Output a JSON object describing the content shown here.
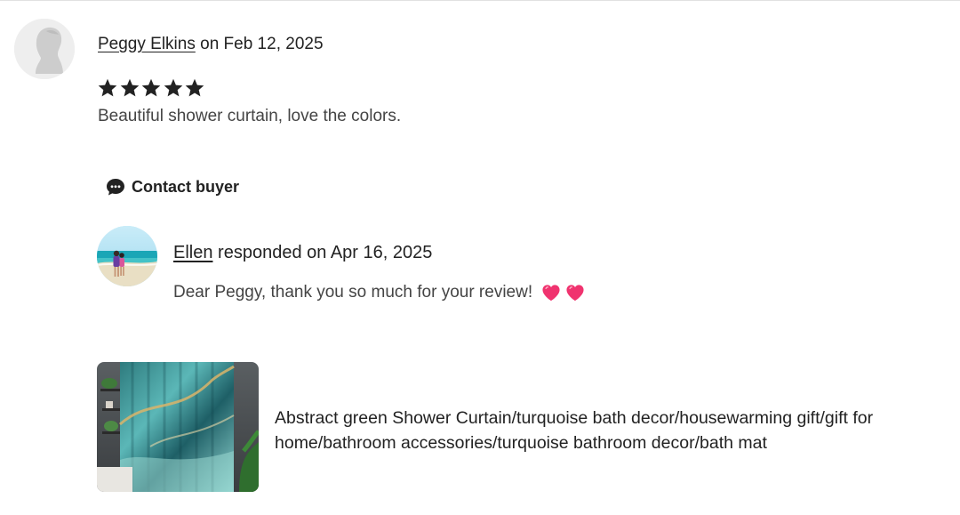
{
  "review": {
    "reviewer_name": "Peggy Elkins",
    "date_text": "on Feb 12, 2025",
    "rating": 5,
    "rating_max": 5,
    "text": "Beautiful shower curtain, love the colors."
  },
  "contact_buyer": {
    "label": "Contact buyer"
  },
  "response": {
    "responder_name": "Ellen",
    "date_text": "responded on Apr 16, 2025",
    "text": "Dear Peggy, thank you so much for your review!"
  },
  "product": {
    "title": "Abstract green Shower Curtain/turquoise bath decor/housewarming gift/gift for home/bathroom accessories/turquoise bathroom decor/bath mat"
  },
  "colors": {
    "star": "#222222",
    "heart": "#f0336f",
    "text_primary": "#222222",
    "text_secondary": "#444444"
  },
  "icons": [
    "default-avatar-icon",
    "star-icon",
    "chat-bubble-icon",
    "heart-icon"
  ]
}
